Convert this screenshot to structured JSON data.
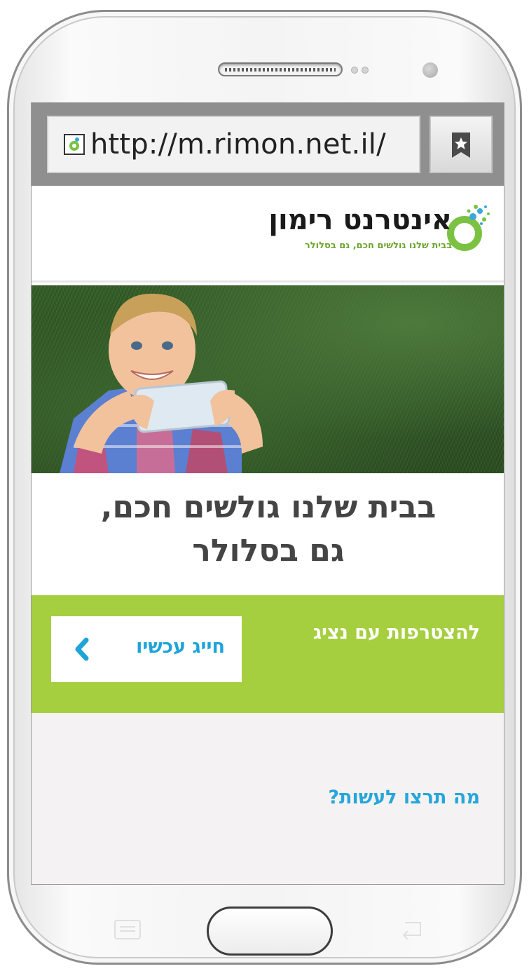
{
  "browser": {
    "url": "http://m.rimon.net.il/",
    "favicon_icon": "rimon-favicon-icon",
    "bookmark_icon": "bookmark-star-icon"
  },
  "header": {
    "logo_title": "אינטרנט רימון",
    "logo_subtitle": "בבית שלנו גולשים חכם, גם בסלולר",
    "brand_green": "#7cc242",
    "brand_blue": "#3aa8d8"
  },
  "hero": {
    "headline_line1": "בבית שלנו גולשים חכם,",
    "headline_line2": "גם בסלולר"
  },
  "cta": {
    "text": "להצטרפות עם נציג",
    "button_label": "חייג עכשיו",
    "background_color": "#a5cf3f",
    "button_text_color": "#1ea4d8"
  },
  "lower": {
    "title": "מה תרצו לעשות?",
    "background_color": "#f5f2f3"
  },
  "device": {
    "menu_key_icon": "menu-icon",
    "back_key_icon": "back-arrow-icon"
  }
}
